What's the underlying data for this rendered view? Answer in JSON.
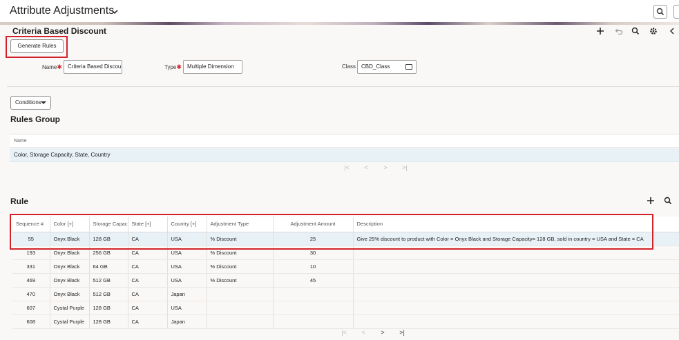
{
  "header": {
    "title": "Attribute Adjustments"
  },
  "section": {
    "title": "Criteria Based Discount"
  },
  "toolbar": {
    "generate_rules_label": "Generate Rules"
  },
  "form": {
    "name_label": "Name",
    "name_value": "Criteria Based Discoun",
    "type_label": "Type",
    "type_value": "Multiple Dimension",
    "class_label": "Class",
    "class_value": "CBD_Class"
  },
  "conditions_label": "Conditions",
  "rules_group": {
    "title": "Rules Group",
    "column_name": "Name",
    "row_value": "Color, Storage Capacity, State, Country"
  },
  "rule": {
    "title": "Rule",
    "columns": [
      "Sequence #",
      "Color [+]",
      "Storage Capacit",
      "State [+]",
      "Country [+]",
      "Adjustment Type",
      "Adjustment Amount",
      "Description"
    ],
    "rows": [
      [
        "55",
        "Onyx Black",
        "128 GB",
        "CA",
        "USA",
        "% Discount",
        "25",
        "Give 25% discount to product with Color = Onyx Black and Storage Capacity= 128 GB, sold in country = USA and State = CA"
      ],
      [
        "193",
        "Onyx Black",
        "256 GB",
        "CA",
        "USA",
        "% Discount",
        "30",
        ""
      ],
      [
        "331",
        "Onyx Black",
        "64 GB",
        "CA",
        "USA",
        "% Discount",
        "10",
        ""
      ],
      [
        "469",
        "Onyx Black",
        "512 GB",
        "CA",
        "USA",
        "% Discount",
        "45",
        ""
      ],
      [
        "470",
        "Onyx Black",
        "512 GB",
        "CA",
        "Japan",
        "",
        "",
        ""
      ],
      [
        "607",
        "Cystal Purple",
        "128 GB",
        "CA",
        "USA",
        "",
        "",
        ""
      ],
      [
        "608",
        "Cystal Purple",
        "128 GB",
        "CA",
        "Japan",
        "",
        "",
        ""
      ]
    ]
  },
  "pager_symbols": {
    "first": "|<",
    "prev": "<",
    "next": ">",
    "last": ">|"
  },
  "colors": {
    "highlight": "#d2232a",
    "selected_row": "#e8f2f6"
  }
}
